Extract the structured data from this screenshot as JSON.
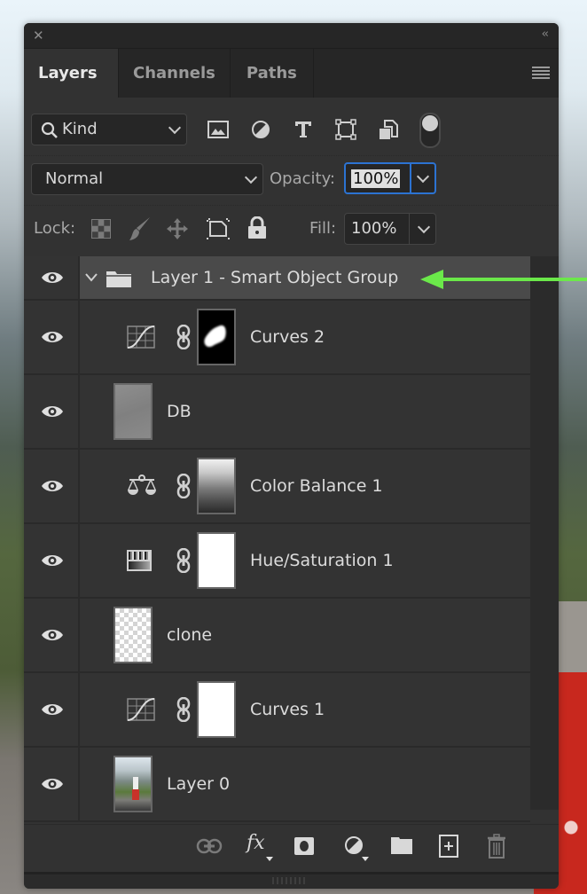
{
  "panel": {
    "tabs": [
      {
        "label": "Layers",
        "active": true
      },
      {
        "label": "Channels",
        "active": false
      },
      {
        "label": "Paths",
        "active": false
      }
    ]
  },
  "filter": {
    "kind_label": "Kind",
    "icons": [
      "pixel-layer-filter-icon",
      "adjustment-layer-filter-icon",
      "type-layer-filter-icon",
      "shape-layer-filter-icon",
      "smart-object-filter-icon",
      "filter-toggle"
    ]
  },
  "blend": {
    "mode": "Normal",
    "opacity_label": "Opacity:",
    "opacity_value": "100%"
  },
  "lock": {
    "label": "Lock:",
    "fill_label": "Fill:",
    "fill_value": "100%"
  },
  "layers": [
    {
      "name": "Layer 1 - Smart Object Group",
      "type": "group",
      "expanded": true,
      "visible": true
    },
    {
      "name": "Curves 2",
      "type": "curves",
      "mask": "black-with-white-blob",
      "visible": true
    },
    {
      "name": "DB",
      "type": "pixel",
      "thumb": "gray",
      "visible": true
    },
    {
      "name": "Color Balance 1",
      "type": "color-balance",
      "mask": "photo",
      "visible": true
    },
    {
      "name": "Hue/Saturation 1",
      "type": "hue-saturation",
      "mask": "white",
      "visible": true
    },
    {
      "name": "clone",
      "type": "pixel",
      "thumb": "transparent",
      "visible": true
    },
    {
      "name": "Curves 1",
      "type": "curves",
      "mask": "white",
      "visible": true
    },
    {
      "name": "Layer 0",
      "type": "pixel",
      "thumb": "photo",
      "visible": true
    }
  ],
  "annotation": {
    "arrow_color": "#6be84a",
    "points_to": "Layer 1 - Smart Object Group"
  },
  "footer": {
    "icons": [
      "link-layers-icon",
      "fx-icon",
      "add-mask-icon",
      "new-adjustment-icon",
      "new-group-icon",
      "new-layer-icon",
      "delete-layer-icon"
    ],
    "fx_label": "fx"
  }
}
